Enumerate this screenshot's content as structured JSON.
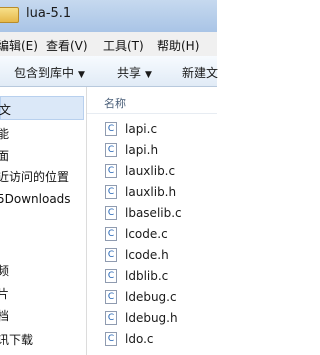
{
  "window": {
    "title": "lua-5.1"
  },
  "menu": [
    "编辑(E)",
    "查看(V)",
    "工具(T)",
    "帮助(H)"
  ],
  "toolbar": {
    "include_in_library": "包含到库中",
    "share": "共享",
    "new_folder": "新建文"
  },
  "nav": [
    "文",
    "能",
    "面",
    "近访问的位置",
    "5Downloads",
    "频",
    "片",
    "档",
    "讯下载"
  ],
  "files": {
    "column_name": "名称",
    "items": [
      "lapi.c",
      "lapi.h",
      "lauxlib.c",
      "lauxlib.h",
      "lbaselib.c",
      "lcode.c",
      "lcode.h",
      "ldblib.c",
      "ldebug.c",
      "ldebug.h",
      "ldo.c"
    ]
  }
}
